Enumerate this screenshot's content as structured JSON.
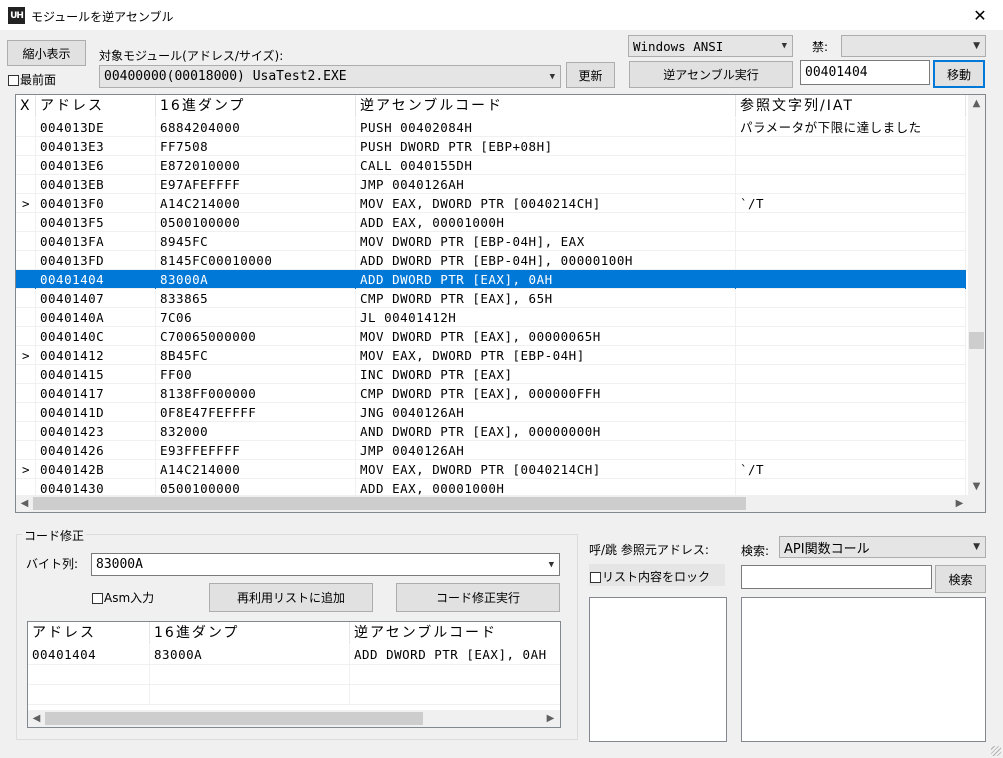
{
  "window": {
    "title": "モジュールを逆アセンブル",
    "icon_text": "UH",
    "close_glyph": "✕"
  },
  "toolbar": {
    "compact_button": "縮小表示",
    "topmost_checkbox": "最前面",
    "module_label": "対象モジュール(アドレス/サイズ):",
    "module_value": "00400000(00018000) UsaTest2.EXE",
    "refresh_button": "更新",
    "encoding_value": "Windows ANSI",
    "forbid_label": "禁:",
    "forbid_value": "",
    "disassemble_button": "逆アセンブル実行",
    "address_value": "00401404",
    "move_button": "移動"
  },
  "main_list": {
    "columns": [
      "X",
      "アドレス",
      "16進ダンプ",
      "逆アセンブルコード",
      "参照文字列/IAT"
    ],
    "rows": [
      {
        "x": "",
        "addr": "004013DE",
        "hex": "6884204000",
        "code": "PUSH 00402084H",
        "ref": "パラメータが下限に達しました"
      },
      {
        "x": "",
        "addr": "004013E3",
        "hex": "FF7508",
        "code": "PUSH DWORD PTR [EBP+08H]",
        "ref": ""
      },
      {
        "x": "",
        "addr": "004013E6",
        "hex": "E872010000",
        "code": "CALL 0040155DH",
        "ref": ""
      },
      {
        "x": "",
        "addr": "004013EB",
        "hex": "E97AFEFFFF",
        "code": "JMP 0040126AH",
        "ref": ""
      },
      {
        "x": ">",
        "addr": "004013F0",
        "hex": "A14C214000",
        "code": "MOV EAX, DWORD PTR [0040214CH]",
        "ref": "`/T"
      },
      {
        "x": "",
        "addr": "004013F5",
        "hex": "0500100000",
        "code": "ADD EAX, 00001000H",
        "ref": ""
      },
      {
        "x": "",
        "addr": "004013FA",
        "hex": "8945FC",
        "code": "MOV DWORD PTR [EBP-04H], EAX",
        "ref": ""
      },
      {
        "x": "",
        "addr": "004013FD",
        "hex": "8145FC00010000",
        "code": "ADD DWORD PTR [EBP-04H], 00000100H",
        "ref": ""
      },
      {
        "x": "",
        "addr": "00401404",
        "hex": "83000A",
        "code": "ADD DWORD PTR [EAX], 0AH",
        "ref": "",
        "selected": true
      },
      {
        "x": "",
        "addr": "00401407",
        "hex": "833865",
        "code": "CMP DWORD PTR [EAX], 65H",
        "ref": ""
      },
      {
        "x": "",
        "addr": "0040140A",
        "hex": "7C06",
        "code": "JL 00401412H",
        "ref": ""
      },
      {
        "x": "",
        "addr": "0040140C",
        "hex": "C70065000000",
        "code": "MOV DWORD PTR [EAX], 00000065H",
        "ref": ""
      },
      {
        "x": ">",
        "addr": "00401412",
        "hex": "8B45FC",
        "code": "MOV EAX, DWORD PTR [EBP-04H]",
        "ref": ""
      },
      {
        "x": "",
        "addr": "00401415",
        "hex": "FF00",
        "code": "INC DWORD PTR [EAX]",
        "ref": ""
      },
      {
        "x": "",
        "addr": "00401417",
        "hex": "8138FF000000",
        "code": "CMP DWORD PTR [EAX], 000000FFH",
        "ref": ""
      },
      {
        "x": "",
        "addr": "0040141D",
        "hex": "0F8E47FEFFFF",
        "code": "JNG 0040126AH",
        "ref": ""
      },
      {
        "x": "",
        "addr": "00401423",
        "hex": "832000",
        "code": "AND DWORD PTR [EAX], 00000000H",
        "ref": ""
      },
      {
        "x": "",
        "addr": "00401426",
        "hex": "E93FFEFFFF",
        "code": "JMP 0040126AH",
        "ref": ""
      },
      {
        "x": ">",
        "addr": "0040142B",
        "hex": "A14C214000",
        "code": "MOV EAX, DWORD PTR [0040214CH]",
        "ref": "`/T"
      },
      {
        "x": "",
        "addr": "00401430",
        "hex": "0500100000",
        "code": "ADD EAX, 00001000H",
        "ref": ""
      }
    ]
  },
  "code_edit": {
    "group_label": "コード修正",
    "bytes_label": "バイト列:",
    "bytes_value": "83000A",
    "asm_checkbox": "Asm入力",
    "add_reuse_button": "再利用リストに追加",
    "apply_button": "コード修正実行",
    "columns": [
      "アドレス",
      "16進ダンプ",
      "逆アセンブルコード"
    ],
    "rows": [
      {
        "addr": "00401404",
        "hex": "83000A",
        "code": "ADD DWORD PTR [EAX], 0AH"
      }
    ]
  },
  "reference": {
    "label": "呼/跳 参照元アドレス:",
    "lock_checkbox": "リスト内容をロック"
  },
  "search": {
    "label": "検索:",
    "type_value": "API関数コール",
    "query_value": "",
    "button": "検索"
  },
  "icons": {
    "dropdown": "chevron-down",
    "scroll_up": "▲",
    "scroll_down": "▼",
    "scroll_left": "◀",
    "scroll_right": "▶"
  },
  "colors": {
    "selection": "#0078d7",
    "default_button_border": "#0078d7"
  }
}
